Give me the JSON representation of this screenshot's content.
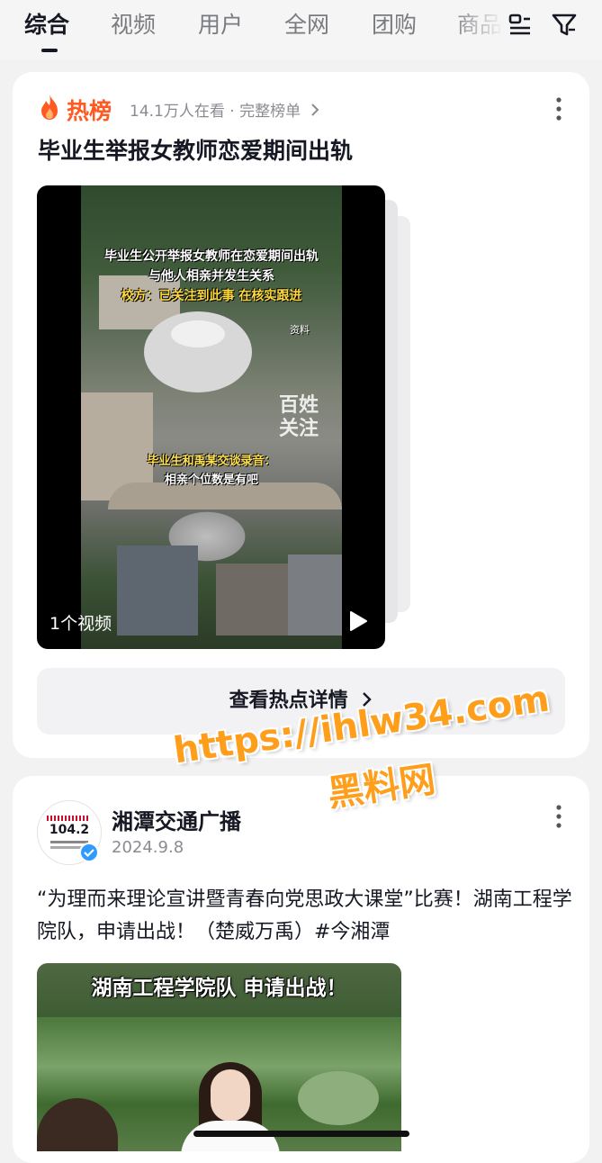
{
  "tabs": [
    "综合",
    "视频",
    "用户",
    "全网",
    "团购",
    "商品"
  ],
  "active_tab": 0,
  "icons": {
    "history": "list-icon",
    "filter": "filter-icon"
  },
  "hot_card": {
    "hot_label": "热榜",
    "meta": "14.1万人在看 · 完整榜单",
    "headline": "毕业生举报女教师恋爱期间出轨",
    "video": {
      "caption_line1": "毕业生公开举报女教师在恋爱期间出轨",
      "caption_line2": "与他人相亲并发生关系",
      "caption_line3": "校方：已关注到此事 在核实跟进",
      "tag_material": "资料",
      "watermark": "百姓\n关注",
      "subtitle_title": "毕业生和禹某交谈录音：",
      "subtitle_text": "相亲个位数是有吧",
      "count": "1个视频"
    },
    "detail_button": "查看热点详情"
  },
  "watermark": {
    "line1": "https://ihlw34.com",
    "line2": "黑料网"
  },
  "post_card": {
    "author": "湘潭交通广播",
    "avatar_text": "104.2",
    "date": "2024.9.8",
    "text": "“为理而来理论宣讲暨青春向党思政大课堂”比赛！湖南工程学院队，申请出战！（楚威万禹）#今湘潭",
    "image_caption": "湖南工程学院队 申请出战！"
  },
  "colors": {
    "hot": "#fe5a22",
    "verified": "#2f9bff",
    "watermark": "#ff9e1b"
  }
}
